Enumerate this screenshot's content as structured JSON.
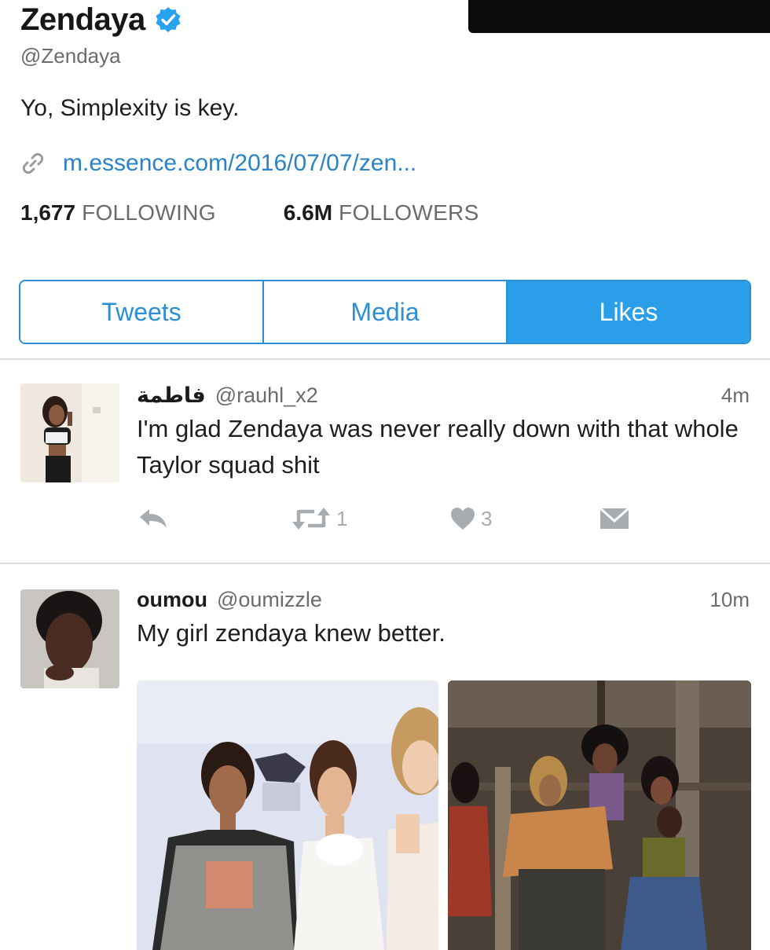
{
  "profile": {
    "name": "Zendaya",
    "handle": "@Zendaya",
    "bio": "Yo, Simplexity is key.",
    "link": "m.essence.com/2016/07/07/zen...",
    "following_count": "1,677",
    "following_label": "FOLLOWING",
    "followers_count": "6.6M",
    "followers_label": "FOLLOWERS"
  },
  "tabs": [
    {
      "label": "Tweets",
      "active": false
    },
    {
      "label": "Media",
      "active": false
    },
    {
      "label": "Likes",
      "active": true
    }
  ],
  "tweets": [
    {
      "name": "فاطمة",
      "handle": "@rauhl_x2",
      "time": "4m",
      "text": "I'm glad Zendaya was never really down with that whole Taylor squad shit",
      "retweets": "1",
      "likes": "3"
    },
    {
      "name": "oumou",
      "handle": "@oumizzle",
      "time": "10m",
      "text": "My girl zendaya knew better."
    }
  ],
  "colors": {
    "accent": "#2a9ee8",
    "link": "#2a83c6",
    "muted": "#6b6b6b",
    "icon": "#a7acb0"
  }
}
